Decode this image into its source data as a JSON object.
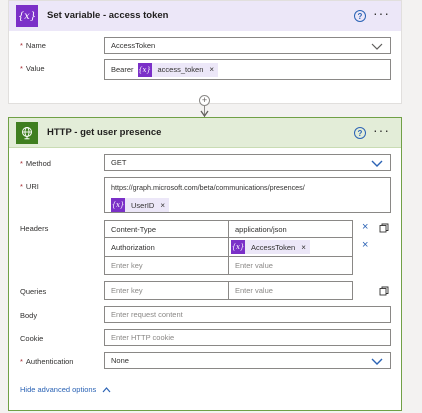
{
  "set_variable_card": {
    "title": "Set variable - access token",
    "icon": "variable-icon",
    "icon_glyph": "{x}",
    "name_label": "Name",
    "name_value": "AccessToken",
    "value_label": "Value",
    "value_prefix": "Bearer",
    "value_token": "access_token"
  },
  "http_card": {
    "title": "HTTP - get user presence",
    "icon": "globe-icon",
    "method_label": "Method",
    "method_value": "GET",
    "uri_label": "URI",
    "uri_value": "https://graph.microsoft.com/beta/communications/presences/",
    "uri_token": "UserID",
    "headers_label": "Headers",
    "headers": [
      {
        "key": "Content-Type",
        "value": "application/json"
      },
      {
        "key": "Authorization",
        "value_token": "AccessToken"
      }
    ],
    "key_placeholder": "Enter key",
    "value_placeholder": "Enter value",
    "queries_label": "Queries",
    "body_label": "Body",
    "body_placeholder": "Enter request content",
    "cookie_label": "Cookie",
    "cookie_placeholder": "Enter HTTP cookie",
    "auth_label": "Authentication",
    "auth_value": "None",
    "advanced_link": "Hide advanced options"
  },
  "common": {
    "required_mark": "*",
    "help_glyph": "?",
    "more_glyph": "···",
    "remove_glyph": "×",
    "add_glyph": "+",
    "token_glyph": "{x}"
  },
  "colors": {
    "variable_accent": "#7b30c8",
    "http_accent": "#3f7f1f",
    "link_blue": "#2b63b5",
    "required_red": "#a4262c"
  }
}
